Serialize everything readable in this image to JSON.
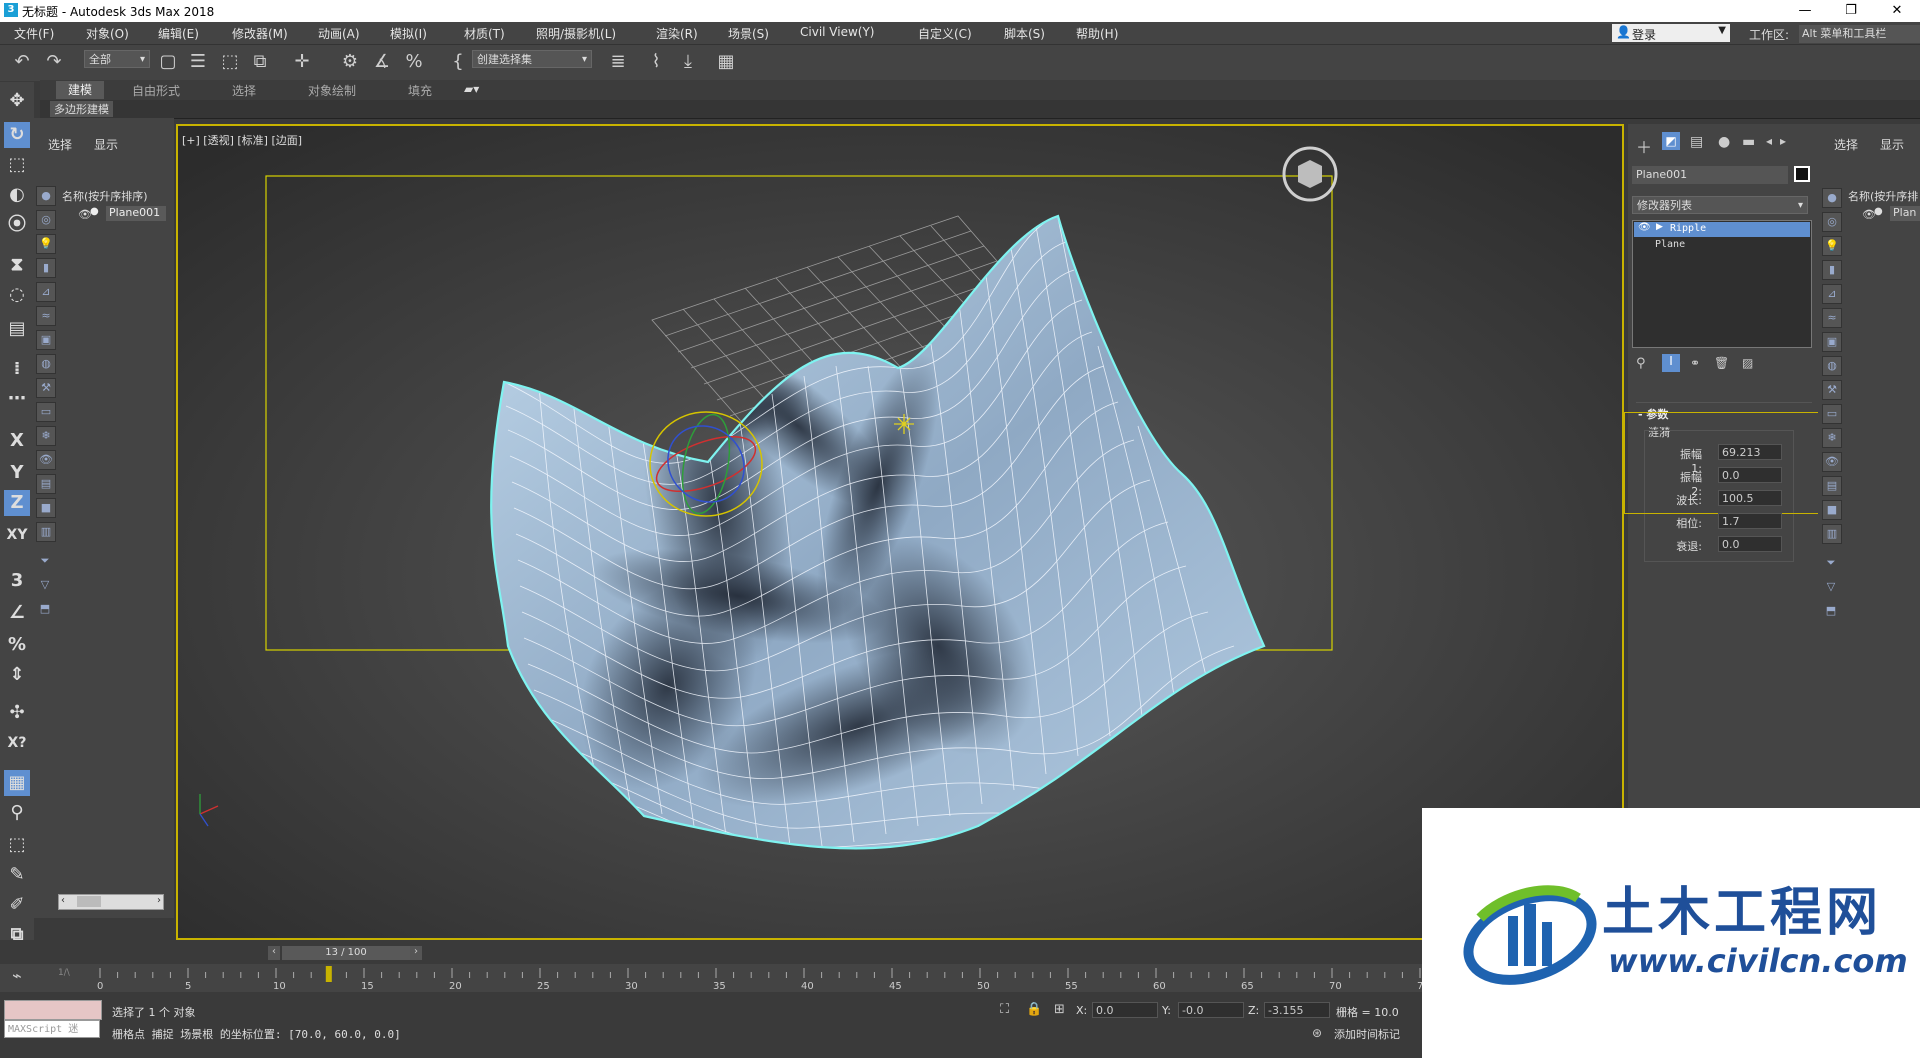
{
  "window": {
    "title": "无标题 - Autodesk 3ds Max 2018",
    "controls": [
      "—",
      "❐",
      "✕"
    ]
  },
  "menubar": {
    "items": [
      "文件(F)",
      "对象(O)",
      "编辑(E)",
      "修改器(M)",
      "动画(A)",
      "模拟(I)",
      "材质(T)",
      "照明/摄影机(L)",
      "渲染(R)",
      "场景(S)",
      "Civil View(Y)",
      "自定义(C)",
      "脚本(S)",
      "帮助(H)"
    ],
    "login": "登录",
    "workspace_label": "工作区:",
    "workspace_value": "Alt 菜单和工具栏"
  },
  "toolbar": {
    "filter": "全部",
    "selection_set": "创建选择集"
  },
  "ribbon": {
    "tabs": [
      "建模",
      "自由形式",
      "选择",
      "对象绘制",
      "填充"
    ],
    "sub": "多边形建模"
  },
  "explorer": {
    "tabs": [
      "选择",
      "显示"
    ],
    "header": "名称(按升序排序)",
    "object": "Plane001"
  },
  "viewport": {
    "label": "[+] [透视] [标准] [边面]"
  },
  "command_panel": {
    "object_name": "Plane001",
    "modifier_list": "修改器列表",
    "stack": [
      "Ripple",
      "Plane"
    ],
    "rollout_title": "参数",
    "group": "涟漪",
    "params": [
      {
        "label": "振幅 1:",
        "value": "69.213"
      },
      {
        "label": "振幅 2:",
        "value": "0.0"
      },
      {
        "label": "波长:",
        "value": "100.5"
      },
      {
        "label": "相位:",
        "value": "1.7"
      },
      {
        "label": "衰退:",
        "value": "0.0"
      }
    ]
  },
  "right_explorer": {
    "tabs": [
      "选择",
      "显示"
    ],
    "header": "名称(按升序排",
    "object": "Plan"
  },
  "timeline": {
    "frame_display": "13 / 100",
    "current_frame": 13,
    "total_frames": 100,
    "ticks": [
      "0",
      "5",
      "10",
      "15",
      "20",
      "25",
      "30",
      "35",
      "40",
      "45",
      "50",
      "55",
      "60",
      "65",
      "70",
      "7"
    ]
  },
  "status": {
    "maxscript": "MAXScript 迷",
    "line1": "选择了 1 个 对象",
    "line2": "栅格点 捕捉 场景根 的坐标位置: [70.0, 60.0, 0.0]",
    "x_label": "X:",
    "x": "0.0",
    "y_label": "Y:",
    "y": "-0.0",
    "z_label": "Z:",
    "z": "-3.155",
    "grid": "栅格 = 10.0",
    "add_time_tag": "添加时间标记"
  },
  "watermark": {
    "title": "土木工程网",
    "url": "www.civilcn.com"
  },
  "colors": {
    "accent": "#c8b300",
    "selection": "#5f8fd0",
    "surface": "#b9d2ea"
  }
}
